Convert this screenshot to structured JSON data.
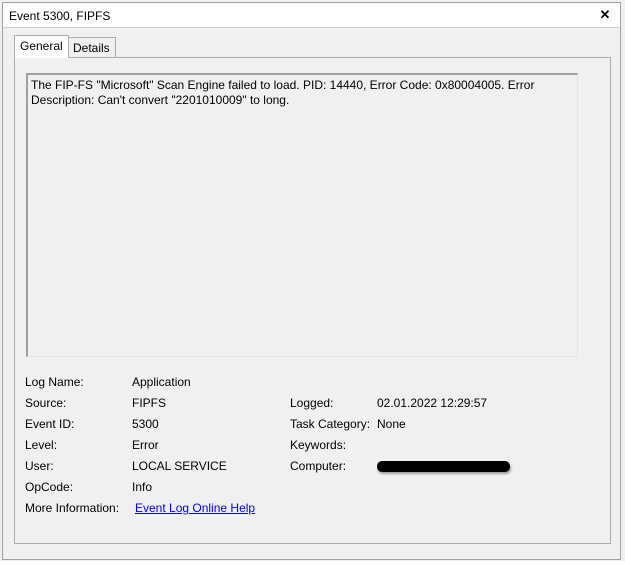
{
  "window": {
    "title": "Event 5300, FIPFS",
    "close_glyph": "✕"
  },
  "tabs": [
    {
      "label": "General",
      "selected": true
    },
    {
      "label": "Details",
      "selected": false
    }
  ],
  "description": "The FIP-FS \"Microsoft\" Scan Engine failed to load. PID: 14440, Error Code: 0x80004005. Error Description: Can't convert \"2201010009\" to long.",
  "fields": {
    "log_name": {
      "label": "Log Name:",
      "value": "Application"
    },
    "source": {
      "label": "Source:",
      "value": "FIPFS"
    },
    "event_id": {
      "label": "Event ID:",
      "value": "5300"
    },
    "level": {
      "label": "Level:",
      "value": "Error"
    },
    "user": {
      "label": "User:",
      "value": "LOCAL SERVICE"
    },
    "opcode": {
      "label": "OpCode:",
      "value": "Info"
    },
    "more_info": {
      "label": "More Information:",
      "value": "Event Log Online Help"
    },
    "logged": {
      "label": "Logged:",
      "value": "02.01.2022 12:29:57"
    },
    "task_category": {
      "label": "Task Category:",
      "value": "None"
    },
    "keywords": {
      "label": "Keywords:",
      "value": ""
    },
    "computer": {
      "label": "Computer:",
      "value": ""
    }
  }
}
